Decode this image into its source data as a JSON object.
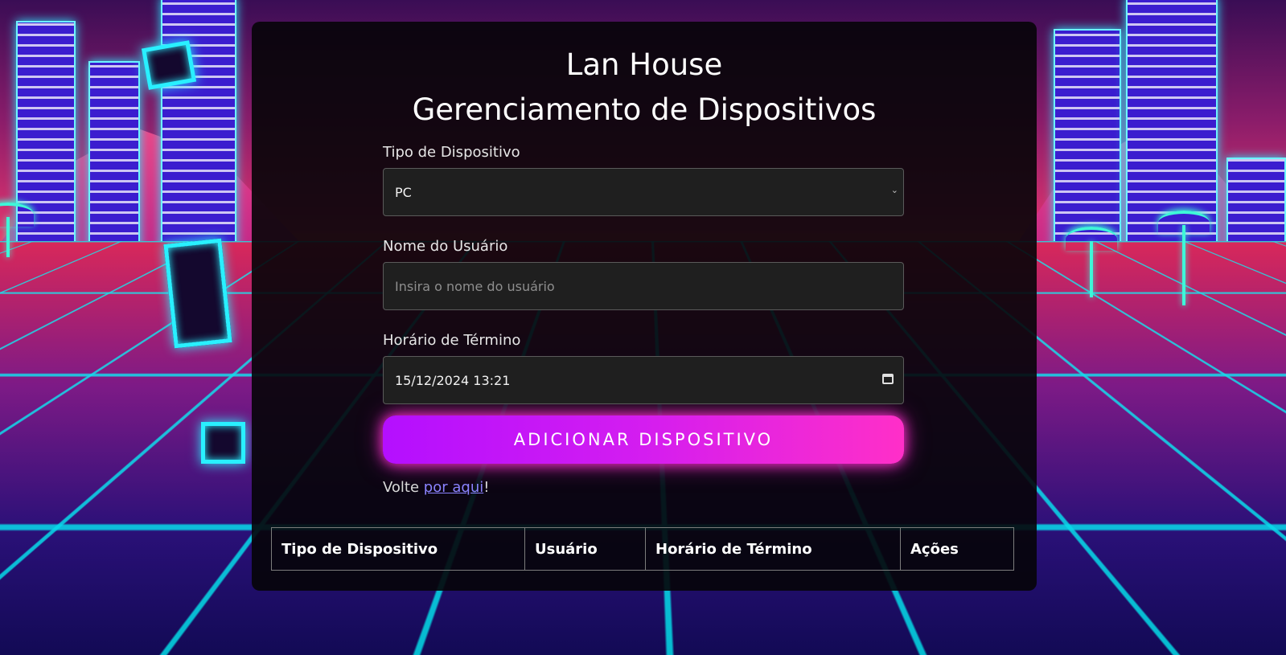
{
  "page": {
    "title_line1": "Lan House",
    "title_line2": "Gerenciamento de Dispositivos"
  },
  "form": {
    "device_type": {
      "label": "Tipo de Dispositivo",
      "selected": "PC"
    },
    "user_name": {
      "label": "Nome do Usuário",
      "placeholder": "Insira o nome do usuário",
      "value": ""
    },
    "end_time": {
      "label": "Horário de Término",
      "value": "15/12/2024 13:21"
    },
    "submit_label": "ADICIONAR DISPOSITIVO"
  },
  "back": {
    "prefix": "Volte ",
    "link_text": "por aqui",
    "suffix": "!"
  },
  "table": {
    "headers": [
      "Tipo de Dispositivo",
      "Usuário",
      "Horário de Término",
      "Ações"
    ],
    "rows": []
  },
  "icons": {
    "select_chevron": "chevron-down-icon",
    "datetime_picker": "calendar-icon"
  },
  "colors": {
    "button_gradient_start": "#b40fff",
    "button_gradient_end": "#ff2fc8",
    "link": "#8b83ff",
    "panel": "#060408"
  }
}
